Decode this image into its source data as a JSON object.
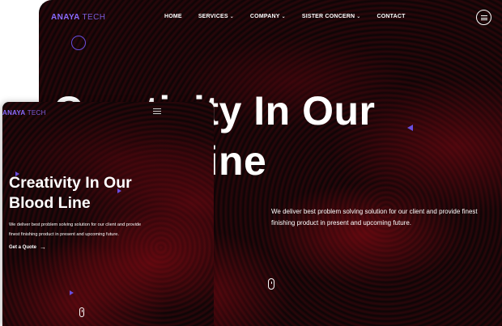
{
  "desktop": {
    "logo": {
      "primary": "ANAYA",
      "secondary": "TECH"
    },
    "nav": [
      {
        "label": "HOME",
        "dropdown": false
      },
      {
        "label": "SERVICES",
        "dropdown": true
      },
      {
        "label": "COMPANY",
        "dropdown": true
      },
      {
        "label": "SISTER CONCERN",
        "dropdown": true
      },
      {
        "label": "CONTACT",
        "dropdown": false
      }
    ],
    "menu_icon": "hamburger-circle-icon",
    "hero": {
      "headline_line1": "Creativity In Our",
      "headline_line2": "Blood Line",
      "description": "We deliver best problem solving solution for our client and provide finest finishing product in present and upcoming future."
    }
  },
  "mobile": {
    "logo": {
      "primary": "ANAYA",
      "secondary": "TECH"
    },
    "menu_icon": "hamburger-icon",
    "hero": {
      "headline_line1": "Creativity In Our",
      "headline_line2": "Blood Line",
      "description_line1": "We deliver best problem solving solution for our client and provide",
      "description_line2": "finest finishing product in present and upcoming future.",
      "cta_label": "Get a Quote"
    }
  },
  "colors": {
    "accent": "#6a4fe0",
    "logo": "#8b6cff",
    "background": "#0b0506",
    "swirl": "#8a0c16",
    "text": "#ffffff"
  }
}
